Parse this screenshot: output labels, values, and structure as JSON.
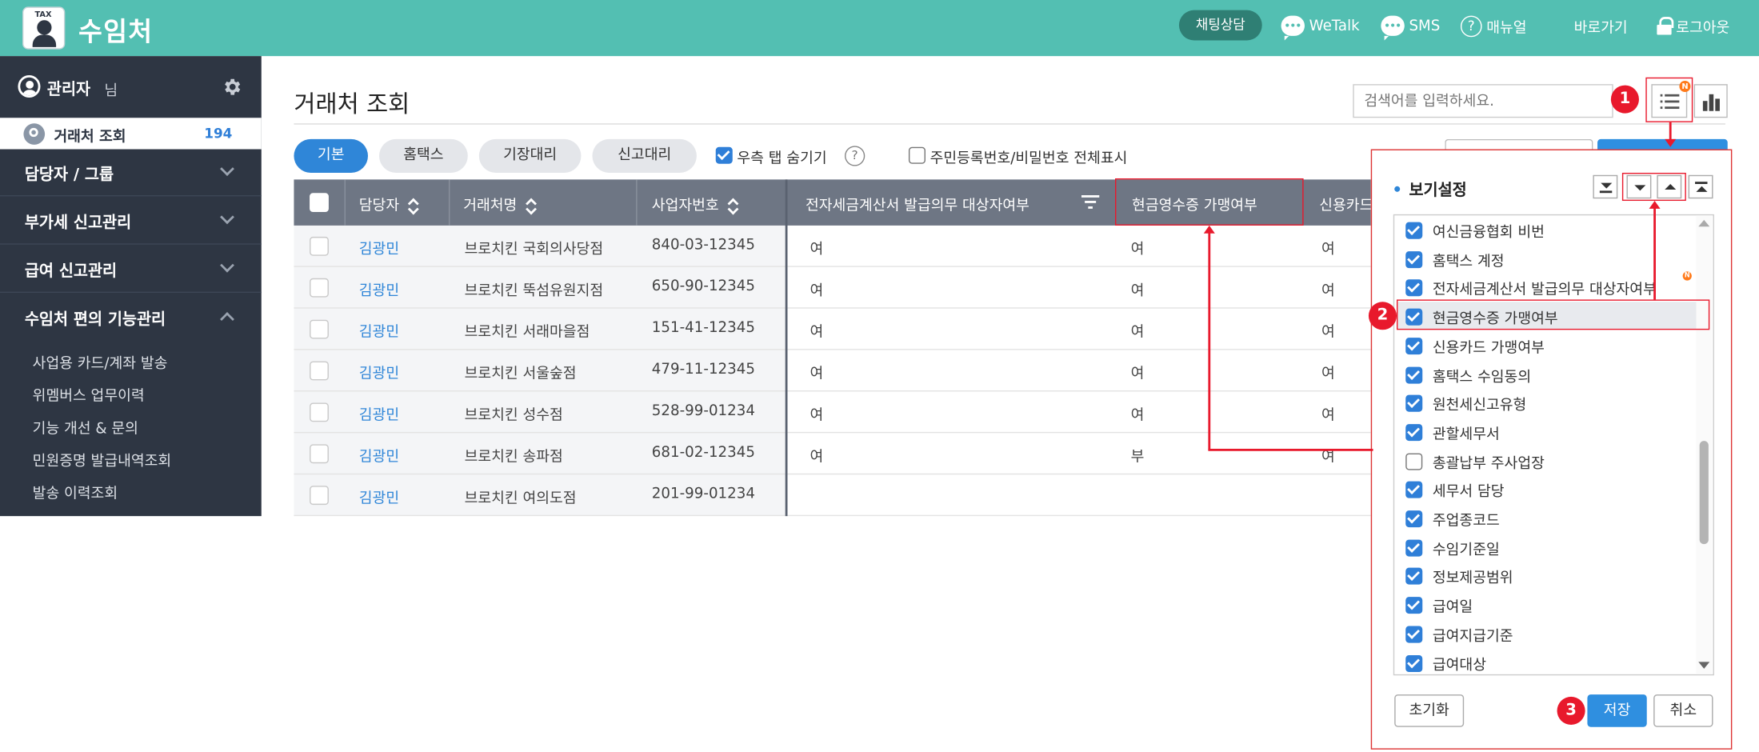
{
  "app": {
    "logo_tag": "TAX",
    "title": "수임처"
  },
  "topbar": {
    "chat": "채팅상담",
    "wetalk": "WeTalk",
    "sms": "SMS",
    "manual": "매뉴얼",
    "shortcut": "바로가기",
    "logout": "로그아웃"
  },
  "sidebar": {
    "user": "관리자",
    "user_suffix": "님",
    "active": {
      "label": "거래처 조회",
      "count": "194"
    },
    "menus": [
      {
        "label": "담당자 / 그룹"
      },
      {
        "label": "부가세 신고관리"
      },
      {
        "label": "급여 신고관리"
      },
      {
        "label": "수임처 편의 기능관리"
      }
    ],
    "subitems": [
      "사업용 카드/계좌 발송",
      "위멤버스 업무이력",
      "기능 개선 & 문의",
      "민원증명 발급내역조회",
      "발송 이력조회"
    ]
  },
  "main": {
    "title": "거래처 조회",
    "search_placeholder": "검색어를 입력하세요.",
    "tabs": [
      "기본",
      "홈택스",
      "기장대리",
      "신고대리"
    ],
    "hide_right_tab": "우측 탭 숨기기",
    "show_ssn": "주민등록번호/비밀번호 전체표시",
    "help": "?"
  },
  "table": {
    "headers": [
      "담당자",
      "거래처명",
      "사업자번호",
      "전자세금계산서 발급의무 대상자여부",
      "현금영수증 가맹여부",
      "신용카드"
    ],
    "rows": [
      {
        "manager": "김광민",
        "name": "브로치킨 국회의사당점",
        "biz": "840-03-12345",
        "einvoice": "여",
        "cash": "여",
        "card": "여"
      },
      {
        "manager": "김광민",
        "name": "브로치킨 뚝섬유원지점",
        "biz": "650-90-12345",
        "einvoice": "여",
        "cash": "여",
        "card": "여"
      },
      {
        "manager": "김광민",
        "name": "브로치킨 서래마을점",
        "biz": "151-41-12345",
        "einvoice": "여",
        "cash": "여",
        "card": "여"
      },
      {
        "manager": "김광민",
        "name": "브로치킨 서울숲점",
        "biz": "479-11-12345",
        "einvoice": "여",
        "cash": "여",
        "card": "여"
      },
      {
        "manager": "김광민",
        "name": "브로치킨 성수점",
        "biz": "528-99-01234",
        "einvoice": "여",
        "cash": "여",
        "card": "여"
      },
      {
        "manager": "김광민",
        "name": "브로치킨 송파점",
        "biz": "681-02-12345",
        "einvoice": "여",
        "cash": "부",
        "card": "여"
      },
      {
        "manager": "김광민",
        "name": "브로치킨 여의도점",
        "biz": "201-99-01234",
        "einvoice": "",
        "cash": "",
        "card": ""
      }
    ]
  },
  "popup": {
    "title": "보기설정",
    "items": [
      {
        "label": "여신금융협회 비번",
        "checked": true
      },
      {
        "label": "홈택스 계정",
        "checked": true
      },
      {
        "label": "전자세금계산서 발급의무 대상자여부",
        "checked": true
      },
      {
        "label": "현금영수증 가맹여부",
        "checked": true
      },
      {
        "label": "신용카드 가맹여부",
        "checked": true
      },
      {
        "label": "홈택스 수임동의",
        "checked": true
      },
      {
        "label": "원천세신고유형",
        "checked": true
      },
      {
        "label": "관할세무서",
        "checked": true
      },
      {
        "label": "총괄납부 주사업장",
        "checked": false
      },
      {
        "label": "세무서 담당",
        "checked": true
      },
      {
        "label": "주업종코드",
        "checked": true
      },
      {
        "label": "수임기준일",
        "checked": true
      },
      {
        "label": "정보제공범위",
        "checked": true
      },
      {
        "label": "급여일",
        "checked": true
      },
      {
        "label": "급여지급기준",
        "checked": true
      },
      {
        "label": "급여대상",
        "checked": true
      }
    ],
    "reset": "초기화",
    "save": "저장",
    "cancel": "취소"
  },
  "annotations": {
    "step1": "1",
    "step2": "2",
    "step3": "3",
    "new_badge": "N"
  },
  "colors": {
    "brand": "#53bfb2",
    "sidebar": "#2e3643",
    "accent": "#2f86d8",
    "highlight": "#e8192c"
  }
}
